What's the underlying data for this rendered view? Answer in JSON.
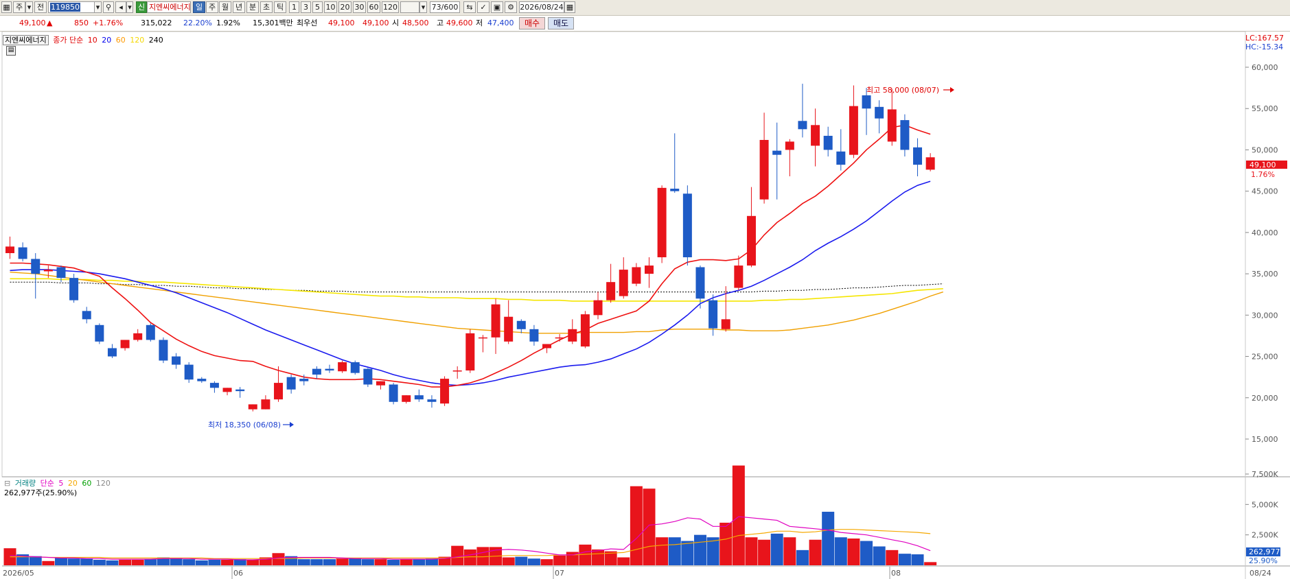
{
  "toolbar": {
    "market_label": "주",
    "board_label": "전",
    "stock_code": "119850",
    "new_badge": "신",
    "stock_name": "지엔씨에너지",
    "periods": [
      "일",
      "주",
      "월",
      "년",
      "분",
      "초",
      "틱"
    ],
    "selected_period": "일",
    "intervals": [
      "1",
      "3",
      "5",
      "10",
      "20",
      "30",
      "60",
      "120"
    ],
    "count": "73/600",
    "date": "2026/08/24"
  },
  "quote": {
    "price": "49,100",
    "up_arrow": "▲",
    "change": "850",
    "change_pct": "+1.76%",
    "volume": "315,022",
    "vol_ratio": "22.20%",
    "turnover": "1.92%",
    "amount": "15,301백만",
    "preferred_label": "최우선",
    "best_ask": "49,100",
    "best_bid": "49,100",
    "open_label": "시",
    "open": "48,500",
    "high_label": "고",
    "high": "49,600",
    "low_label": "저",
    "low": "47,400",
    "buy_button": "매수",
    "sell_button": "매도"
  },
  "price_legend": {
    "name": "지엔씨에너지",
    "title": "종가 단순",
    "periods": [
      "10",
      "20",
      "60",
      "120",
      "240"
    ],
    "colors": [
      "#e00000",
      "#0000ee",
      "#ff9900",
      "#f5d800",
      "#000000"
    ]
  },
  "volume_legend": {
    "title": "거래량",
    "title2": "단순",
    "periods": [
      "5",
      "20",
      "60",
      "120"
    ],
    "colors": [
      "#e000c0",
      "#f5a800",
      "#00a000",
      "#888888"
    ],
    "value": "262,977주(25.90%)"
  },
  "right_panel": {
    "lc": "LC:167.57",
    "hc": "HC:-15.34",
    "price_tag": "49,100",
    "pct_tag": "1.76%",
    "vol_tag": "262,977",
    "vol_pct_tag": "25.90%"
  },
  "annotations": {
    "high": "최고 58,000 (08/07)",
    "low": "최저 18,350 (06/08)"
  },
  "x_labels": [
    "2026/05",
    "06",
    "07",
    "08",
    "08/24"
  ],
  "colors": {
    "up": "#e8141b",
    "down": "#1e5bc6"
  },
  "chart_data": {
    "type": "candlestick",
    "price_ticks": [
      15000,
      20000,
      25000,
      30000,
      35000,
      40000,
      45000,
      50000,
      55000,
      60000
    ],
    "price_tick_labels": [
      "15,000",
      "20,000",
      "25,000",
      "30,000",
      "35,000",
      "40,000",
      "45,000",
      "50,000",
      "55,000",
      "60,000"
    ],
    "volume_ticks": [
      2500,
      5000,
      7500
    ],
    "volume_tick_labels": [
      "2,500K",
      "5,000K",
      "7,500K"
    ],
    "candles": [
      {
        "o": 37500,
        "h": 39500,
        "l": 36800,
        "c": 38300
      },
      {
        "o": 38200,
        "h": 38800,
        "l": 36500,
        "c": 36800
      },
      {
        "o": 36800,
        "h": 37500,
        "l": 32000,
        "c": 35000
      },
      {
        "o": 35300,
        "h": 36000,
        "l": 34500,
        "c": 35500
      },
      {
        "o": 35800,
        "h": 36000,
        "l": 34000,
        "c": 34500
      },
      {
        "o": 34500,
        "h": 35000,
        "l": 31500,
        "c": 31800
      },
      {
        "o": 30500,
        "h": 31000,
        "l": 29000,
        "c": 29500
      },
      {
        "o": 28800,
        "h": 29000,
        "l": 26500,
        "c": 26800
      },
      {
        "o": 26000,
        "h": 26500,
        "l": 24800,
        "c": 25000
      },
      {
        "o": 26000,
        "h": 27000,
        "l": 25700,
        "c": 27000
      },
      {
        "o": 27000,
        "h": 28300,
        "l": 26800,
        "c": 27800
      },
      {
        "o": 28800,
        "h": 29000,
        "l": 26800,
        "c": 27000
      },
      {
        "o": 27000,
        "h": 27300,
        "l": 24200,
        "c": 24500
      },
      {
        "o": 25000,
        "h": 25400,
        "l": 23500,
        "c": 24000
      },
      {
        "o": 24000,
        "h": 24300,
        "l": 21800,
        "c": 22200
      },
      {
        "o": 22300,
        "h": 22500,
        "l": 21800,
        "c": 22000
      },
      {
        "o": 21800,
        "h": 22000,
        "l": 20600,
        "c": 21200
      },
      {
        "o": 20700,
        "h": 21200,
        "l": 20300,
        "c": 21200
      },
      {
        "o": 21000,
        "h": 21300,
        "l": 20000,
        "c": 20800
      },
      {
        "o": 18600,
        "h": 19200,
        "l": 18350,
        "c": 19200
      },
      {
        "o": 18600,
        "h": 20300,
        "l": 18600,
        "c": 19800
      },
      {
        "o": 19800,
        "h": 23800,
        "l": 19500,
        "c": 21800
      },
      {
        "o": 22500,
        "h": 22800,
        "l": 20500,
        "c": 21000
      },
      {
        "o": 22300,
        "h": 22800,
        "l": 21500,
        "c": 22000
      },
      {
        "o": 23500,
        "h": 23800,
        "l": 22300,
        "c": 22800
      },
      {
        "o": 23500,
        "h": 24000,
        "l": 23000,
        "c": 23300
      },
      {
        "o": 23200,
        "h": 24500,
        "l": 23000,
        "c": 24300
      },
      {
        "o": 24300,
        "h": 24500,
        "l": 22800,
        "c": 23000
      },
      {
        "o": 23500,
        "h": 23600,
        "l": 21300,
        "c": 21600
      },
      {
        "o": 21500,
        "h": 22000,
        "l": 21000,
        "c": 22000
      },
      {
        "o": 21600,
        "h": 21800,
        "l": 19200,
        "c": 19500
      },
      {
        "o": 19500,
        "h": 20300,
        "l": 19300,
        "c": 20300
      },
      {
        "o": 20300,
        "h": 21000,
        "l": 19500,
        "c": 19800
      },
      {
        "o": 19800,
        "h": 20300,
        "l": 18800,
        "c": 19500
      },
      {
        "o": 19300,
        "h": 22600,
        "l": 19000,
        "c": 22300
      },
      {
        "o": 23300,
        "h": 23800,
        "l": 22300,
        "c": 23300
      },
      {
        "o": 23300,
        "h": 28300,
        "l": 23000,
        "c": 27800
      },
      {
        "o": 27300,
        "h": 27600,
        "l": 25500,
        "c": 27300
      },
      {
        "o": 27300,
        "h": 32000,
        "l": 25300,
        "c": 31300
      },
      {
        "o": 26800,
        "h": 31800,
        "l": 26500,
        "c": 29800
      },
      {
        "o": 29300,
        "h": 29500,
        "l": 27800,
        "c": 28300
      },
      {
        "o": 28300,
        "h": 28800,
        "l": 26300,
        "c": 26800
      },
      {
        "o": 26000,
        "h": 26500,
        "l": 25400,
        "c": 26500
      },
      {
        "o": 27300,
        "h": 27700,
        "l": 26800,
        "c": 27300
      },
      {
        "o": 26800,
        "h": 29500,
        "l": 26500,
        "c": 28300
      },
      {
        "o": 26200,
        "h": 30500,
        "l": 26000,
        "c": 30100
      },
      {
        "o": 30000,
        "h": 32800,
        "l": 29500,
        "c": 31800
      },
      {
        "o": 31800,
        "h": 36200,
        "l": 31500,
        "c": 34000
      },
      {
        "o": 32300,
        "h": 37000,
        "l": 32000,
        "c": 35500
      },
      {
        "o": 33800,
        "h": 36300,
        "l": 33500,
        "c": 35800
      },
      {
        "o": 35000,
        "h": 37000,
        "l": 33300,
        "c": 36000
      },
      {
        "o": 37000,
        "h": 45700,
        "l": 36300,
        "c": 45400
      },
      {
        "o": 45300,
        "h": 52000,
        "l": 44800,
        "c": 45000
      },
      {
        "o": 44700,
        "h": 45700,
        "l": 36000,
        "c": 37000
      },
      {
        "o": 35800,
        "h": 36000,
        "l": 30800,
        "c": 32000
      },
      {
        "o": 31800,
        "h": 32500,
        "l": 27500,
        "c": 28400
      },
      {
        "o": 28300,
        "h": 33500,
        "l": 28000,
        "c": 29500
      },
      {
        "o": 33300,
        "h": 37200,
        "l": 33000,
        "c": 36000
      },
      {
        "o": 36000,
        "h": 45500,
        "l": 35800,
        "c": 42000
      },
      {
        "o": 44000,
        "h": 54500,
        "l": 43500,
        "c": 51200
      },
      {
        "o": 49900,
        "h": 53300,
        "l": 44000,
        "c": 49400
      },
      {
        "o": 50000,
        "h": 51300,
        "l": 46800,
        "c": 51000
      },
      {
        "o": 53500,
        "h": 58000,
        "l": 51500,
        "c": 52500
      },
      {
        "o": 50500,
        "h": 55000,
        "l": 48000,
        "c": 53000
      },
      {
        "o": 51700,
        "h": 52800,
        "l": 49200,
        "c": 50000
      },
      {
        "o": 49800,
        "h": 52500,
        "l": 47500,
        "c": 48200
      },
      {
        "o": 49400,
        "h": 57800,
        "l": 49000,
        "c": 55300
      },
      {
        "o": 56600,
        "h": 57500,
        "l": 51800,
        "c": 55000
      },
      {
        "o": 55200,
        "h": 56000,
        "l": 52000,
        "c": 53800
      },
      {
        "o": 51000,
        "h": 57400,
        "l": 50500,
        "c": 54900
      },
      {
        "o": 53600,
        "h": 54300,
        "l": 49200,
        "c": 50000
      },
      {
        "o": 50300,
        "h": 51400,
        "l": 46800,
        "c": 48200
      },
      {
        "o": 47600,
        "h": 49600,
        "l": 47400,
        "c": 49100
      }
    ],
    "volumes": [
      1400,
      900,
      750,
      350,
      600,
      550,
      550,
      450,
      400,
      450,
      450,
      500,
      650,
      550,
      500,
      400,
      450,
      450,
      500,
      450,
      650,
      1000,
      750,
      500,
      500,
      500,
      550,
      550,
      500,
      500,
      450,
      500,
      500,
      550,
      700,
      1600,
      1300,
      1500,
      1500,
      650,
      700,
      550,
      500,
      800,
      1100,
      1700,
      1300,
      1150,
      650,
      6500,
      6300,
      2300,
      2300,
      2000,
      2500,
      2300,
      3500,
      8200,
      2300,
      2100,
      2600,
      2300,
      1250,
      2100,
      4400,
      2300,
      2200,
      2000,
      1550,
      1250,
      950,
      900,
      262
    ],
    "ma10": [
      36300,
      36300,
      36200,
      36100,
      35900,
      35700,
      35200,
      34700,
      33300,
      32000,
      30600,
      29100,
      28100,
      27100,
      26300,
      25600,
      25100,
      24800,
      24500,
      24400,
      23800,
      23300,
      22900,
      22500,
      22300,
      22200,
      22200,
      22200,
      22300,
      22200,
      22000,
      21800,
      21600,
      21300,
      21300,
      21500,
      21800,
      22300,
      23000,
      23700,
      24500,
      25400,
      26200,
      27000,
      27700,
      28200,
      29000,
      29500,
      30000,
      30500,
      31700,
      33800,
      35600,
      36400,
      36700,
      36700,
      36600,
      36800,
      37900,
      39700,
      41200,
      42300,
      43500,
      44400,
      45600,
      47000,
      48400,
      50000,
      51300,
      52700,
      53000,
      52400,
      51900
    ],
    "ma20": [
      35400,
      35500,
      35500,
      35500,
      35400,
      35300,
      35200,
      35000,
      34700,
      34400,
      34000,
      33600,
      33200,
      32700,
      32100,
      31500,
      30900,
      30300,
      29600,
      28900,
      28200,
      27600,
      27000,
      26400,
      25800,
      25200,
      24600,
      24100,
      23700,
      23300,
      22800,
      22400,
      22100,
      21800,
      21600,
      21500,
      21600,
      21800,
      22100,
      22500,
      22800,
      23100,
      23400,
      23700,
      23900,
      24000,
      24300,
      24700,
      25300,
      25900,
      26700,
      27700,
      28800,
      30000,
      31400,
      32100,
      32600,
      33000,
      33500,
      34200,
      35000,
      35800,
      36700,
      37800,
      38700,
      39500,
      40400,
      41400,
      42600,
      43800,
      44900,
      45700,
      46200
    ],
    "ma60": [
      35200,
      35100,
      35000,
      34800,
      34600,
      34400,
      34200,
      34000,
      33800,
      33600,
      33400,
      33200,
      33000,
      32800,
      32600,
      32400,
      32200,
      32000,
      31800,
      31600,
      31400,
      31200,
      31000,
      30800,
      30600,
      30400,
      30200,
      30000,
      29800,
      29600,
      29400,
      29200,
      29000,
      28800,
      28600,
      28400,
      28300,
      28200,
      28100,
      28000,
      27900,
      27800,
      27800,
      27800,
      27800,
      27900,
      27900,
      27900,
      27900,
      28000,
      28000,
      28200,
      28300,
      28300,
      28300,
      28300,
      28200,
      28200,
      28100,
      28100,
      28100,
      28200,
      28400,
      28600,
      28800,
      29100,
      29400,
      29800,
      30200,
      30700,
      31200,
      31700,
      32300,
      32800
    ],
    "ma120": [
      34400,
      34400,
      34400,
      34400,
      34300,
      34300,
      34300,
      34200,
      34200,
      34100,
      34100,
      34000,
      34000,
      33900,
      33800,
      33700,
      33600,
      33500,
      33400,
      33300,
      33200,
      33100,
      33000,
      32900,
      32800,
      32700,
      32600,
      32500,
      32400,
      32300,
      32300,
      32200,
      32200,
      32100,
      32100,
      32100,
      32000,
      32000,
      32000,
      31900,
      31900,
      31800,
      31800,
      31800,
      31700,
      31700,
      31700,
      31700,
      31700,
      31700,
      31700,
      31700,
      31700,
      31700,
      31700,
      31700,
      31700,
      31700,
      31700,
      31800,
      31800,
      31900,
      31900,
      32000,
      32100,
      32200,
      32300,
      32400,
      32500,
      32600,
      32800,
      33000,
      33100,
      33200
    ],
    "ma240": [
      34000,
      34000,
      34000,
      34000,
      33900,
      33900,
      33900,
      33800,
      33800,
      33700,
      33700,
      33600,
      33600,
      33500,
      33500,
      33400,
      33300,
      33300,
      33200,
      33200,
      33100,
      33100,
      33000,
      33000,
      32900,
      32900,
      32900,
      32800,
      32800,
      32800,
      32800,
      32800,
      32800,
      32800,
      32800,
      32800,
      32800,
      32800,
      32800,
      32800,
      32800,
      32800,
      32800,
      32800,
      32800,
      32800,
      32800,
      32800,
      32800,
      32800,
      32800,
      32800,
      32800,
      32800,
      32800,
      32800,
      32800,
      32800,
      32800,
      32900,
      32900,
      33000,
      33000,
      33100,
      33100,
      33200,
      33300,
      33300,
      33400,
      33500,
      33600,
      33600,
      33700,
      33800
    ],
    "vma5": [
      800,
      750,
      700,
      650,
      600,
      600,
      550,
      550,
      500,
      500,
      500,
      500,
      550,
      550,
      550,
      500,
      500,
      500,
      450,
      450,
      500,
      600,
      650,
      650,
      650,
      650,
      600,
      550,
      550,
      550,
      500,
      500,
      500,
      500,
      550,
      700,
      850,
      1050,
      1250,
      1300,
      1250,
      1150,
      1000,
      850,
      850,
      1100,
      1200,
      1350,
      1300,
      2200,
      3300,
      3400,
      3600,
      3900,
      3800,
      3200,
      3200,
      4000,
      3900,
      3800,
      3700,
      3200,
      3100,
      3000,
      2900,
      2700,
      2600,
      2500,
      2300,
      2100,
      1900,
      1600,
      1200
    ],
    "vma20": [
      700,
      700,
      700,
      650,
      650,
      650,
      650,
      650,
      600,
      600,
      600,
      600,
      600,
      600,
      600,
      600,
      550,
      550,
      550,
      550,
      550,
      550,
      550,
      600,
      600,
      600,
      600,
      600,
      600,
      600,
      600,
      600,
      600,
      600,
      600,
      650,
      700,
      700,
      750,
      800,
      800,
      800,
      800,
      850,
      850,
      900,
      950,
      1000,
      1050,
      1300,
      1550,
      1650,
      1700,
      1800,
      1900,
      2000,
      2150,
      2450,
      2550,
      2650,
      2800,
      2800,
      2700,
      2750,
      2900,
      2950,
      2950,
      2900,
      2850,
      2800,
      2750,
      2700,
      2600
    ]
  }
}
